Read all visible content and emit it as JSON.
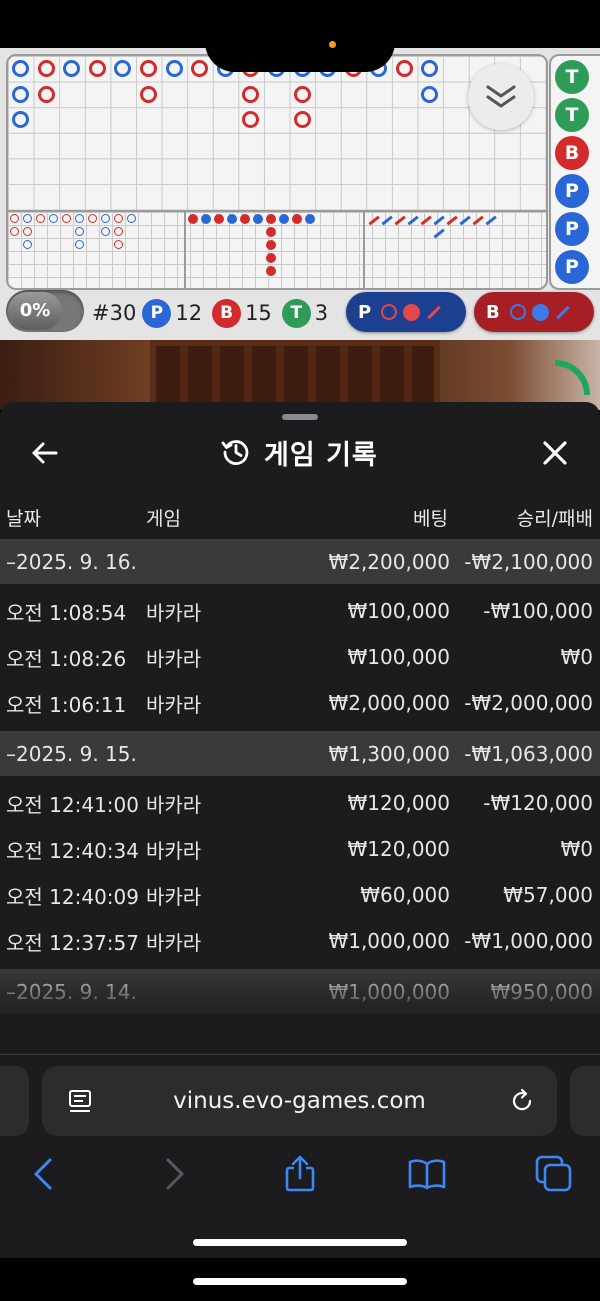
{
  "scoreboard": {
    "toggle_label": "0%",
    "round_label": "#30",
    "player_letter": "P",
    "player_count": "12",
    "banker_letter": "B",
    "banker_count": "15",
    "tie_letter": "T",
    "tie_count": "3",
    "player_ask_letter": "P",
    "banker_ask_letter": "B",
    "predictions": [
      "T",
      "T",
      "B",
      "P",
      "P",
      "P"
    ],
    "colors": {
      "player": "#2a66d6",
      "banker": "#d32b2b",
      "tie": "#2f9b58"
    }
  },
  "panel": {
    "title": "게임 기록",
    "icons": {
      "back": "arrow-left-icon",
      "history": "history-icon",
      "close": "close-icon"
    },
    "columns": {
      "date": "날짜",
      "game": "게임",
      "bet": "베팅",
      "result": "승리/패배"
    },
    "groups": [
      {
        "date": "–2025. 9. 16.",
        "bet": "₩2,200,000",
        "result": "-₩2,100,000",
        "rows": [
          {
            "time": "오전 1:08:54",
            "game": "바카라",
            "bet": "₩100,000",
            "result": "-₩100,000"
          },
          {
            "time": "오전 1:08:26",
            "game": "바카라",
            "bet": "₩100,000",
            "result": "₩0"
          },
          {
            "time": "오전 1:06:11",
            "game": "바카라",
            "bet": "₩2,000,000",
            "result": "-₩2,000,000"
          }
        ]
      },
      {
        "date": "–2025. 9. 15.",
        "bet": "₩1,300,000",
        "result": "-₩1,063,000",
        "rows": [
          {
            "time": "오전 12:41:00",
            "game": "바카라",
            "bet": "₩120,000",
            "result": "-₩120,000"
          },
          {
            "time": "오전 12:40:34",
            "game": "바카라",
            "bet": "₩120,000",
            "result": "₩0"
          },
          {
            "time": "오전 12:40:09",
            "game": "바카라",
            "bet": "₩60,000",
            "result": "₩57,000"
          },
          {
            "time": "오전 12:37:57",
            "game": "바카라",
            "bet": "₩1,000,000",
            "result": "-₩1,000,000"
          }
        ]
      },
      {
        "date": "–2025. 9. 14.",
        "bet": "₩1,000,000",
        "result": "₩950,000",
        "rows": []
      }
    ]
  },
  "browser": {
    "url": "vinus.evo-games.com",
    "icons": {
      "reader": "reader-icon",
      "reload": "reload-icon",
      "back": "chevron-left-icon",
      "forward": "chevron-right-icon",
      "share": "share-icon",
      "bookmarks": "book-icon",
      "tabs": "tabs-icon"
    }
  }
}
